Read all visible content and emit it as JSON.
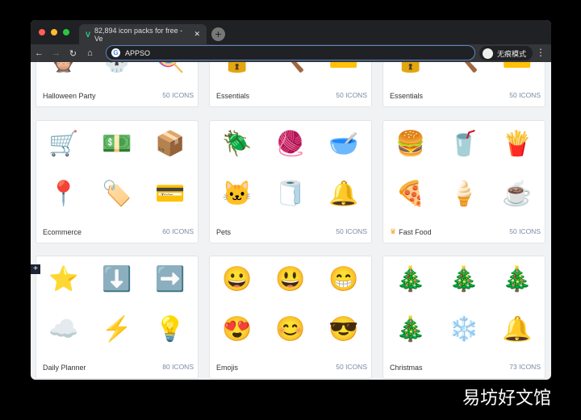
{
  "browser": {
    "tab_title": "82,894 icon packs for free - Ve",
    "address": "APPSO",
    "incognito_label": "无痕模式"
  },
  "cards": [
    {
      "name": "Halloween Party",
      "count": "50 ICONS",
      "icons": [
        "🦉",
        "💀",
        "🍭"
      ]
    },
    {
      "name": "Essentials",
      "count": "50 ICONS",
      "icons": [
        "🔒",
        "🔨",
        "💳"
      ]
    },
    {
      "name": "Essentials",
      "count": "50 ICONS",
      "icons": [
        "🔒",
        "🔨",
        "💳"
      ]
    },
    {
      "name": "Ecommerce",
      "count": "60 ICONS",
      "icons": [
        "🛒",
        "💵",
        "📦",
        "📍",
        "🏷️",
        "💳"
      ]
    },
    {
      "name": "Pets",
      "count": "50 ICONS",
      "icons": [
        "🪲",
        "🧶",
        "🥣",
        "🐱",
        "🧻",
        "🔔"
      ]
    },
    {
      "name": "Fast Food",
      "count": "50 ICONS",
      "badge": "crown-icon",
      "icons": [
        "🍔",
        "🥤",
        "🍟",
        "🍕",
        "🍦",
        "☕"
      ]
    },
    {
      "name": "Daily Planner",
      "count": "80 ICONS",
      "icons": [
        "⭐",
        "⬇️",
        "➡️",
        "☁️",
        "⚡",
        "💡"
      ]
    },
    {
      "name": "Emojis",
      "count": "50 ICONS",
      "icons": [
        "😀",
        "😃",
        "😁",
        "😍",
        "😊",
        "😎"
      ]
    },
    {
      "name": "Christmas",
      "count": "73 ICONS",
      "icons": [
        "🎄",
        "🎄",
        "🎄",
        "🎄",
        "❄️",
        "🔔"
      ]
    }
  ],
  "watermark": "易坊好文馆"
}
